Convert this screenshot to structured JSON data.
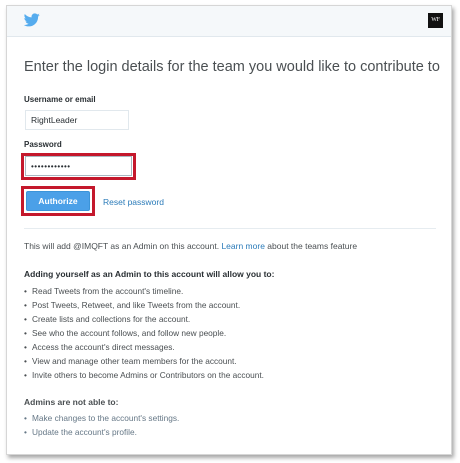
{
  "header": {
    "brand_icon": "twitter-bird-icon",
    "brand_color": "#55acee",
    "avatar_text": "WF"
  },
  "form": {
    "heading": "Enter the login details for the team you would like to contribute to",
    "username_label": "Username or email",
    "username_value": "RightLeader",
    "password_label": "Password",
    "password_value": "••••••••••••",
    "authorize_label": "Authorize",
    "reset_label": "Reset password",
    "accent_color": "#4ba0e8",
    "highlight_color": "#c4182c"
  },
  "info": {
    "prefix": "This will add @IMQFT as an Admin on this account. ",
    "learn_more": "Learn more",
    "suffix": " about the teams feature"
  },
  "allow": {
    "title": "Adding yourself as an Admin to this account will allow you to:",
    "items": [
      "Read Tweets from the account's timeline.",
      "Post Tweets, Retweet, and like Tweets from the account.",
      "Create lists and collections for the account.",
      "See who the account follows, and follow new people.",
      "Access the account's direct messages.",
      "View and manage other team members for the account.",
      "Invite others to become Admins or Contributors on the account."
    ]
  },
  "not_allowed": {
    "title": "Admins are not able to:",
    "items": [
      "Make changes to the account's settings.",
      "Update the account's profile."
    ]
  }
}
